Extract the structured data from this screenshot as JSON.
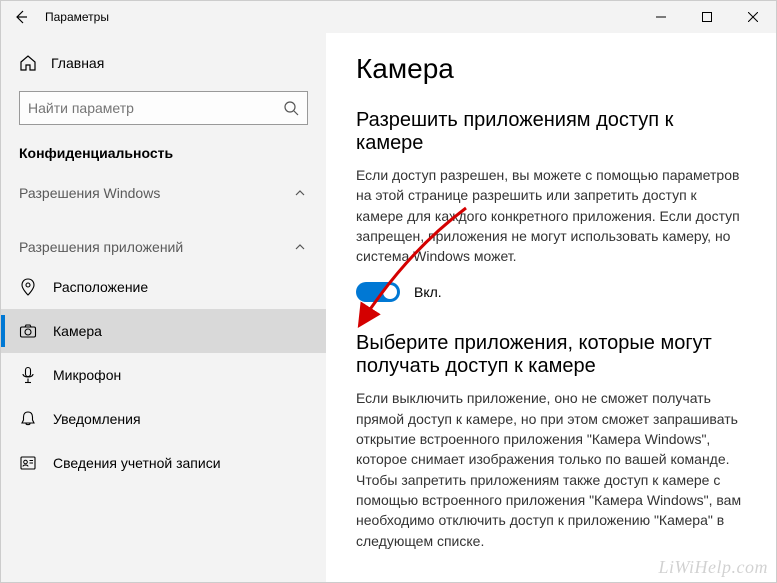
{
  "window": {
    "title": "Параметры"
  },
  "sidebar": {
    "home": "Главная",
    "search_placeholder": "Найти параметр",
    "section": "Конфиденциальность",
    "group1": "Разрешения Windows",
    "group2": "Разрешения приложений",
    "items": [
      {
        "label": "Расположение"
      },
      {
        "label": "Камера"
      },
      {
        "label": "Микрофон"
      },
      {
        "label": "Уведомления"
      },
      {
        "label": "Сведения учетной записи"
      }
    ]
  },
  "content": {
    "h1": "Камера",
    "section1_h": "Разрешить приложениям доступ к камере",
    "section1_p": "Если доступ разрешен, вы можете с помощью параметров на этой странице разрешить или запретить доступ к камере для каждого конкретного приложения. Если доступ запрещен, приложения не могут использовать камеру, но система Windows может.",
    "toggle_state": "Вкл.",
    "section2_h": "Выберите приложения, которые могут получать доступ к камере",
    "section2_p": "Если выключить приложение, оно не сможет получать прямой доступ к камере, но при этом сможет запрашивать открытие встроенного приложения \"Камера Windows\", которое снимает изображения только по вашей команде. Чтобы запретить приложениям также доступ к камере с помощью встроенного приложения \"Камера Windows\", вам необходимо отключить доступ к приложению \"Камера\" в следующем списке."
  },
  "watermark": "LiWiHelp.com"
}
